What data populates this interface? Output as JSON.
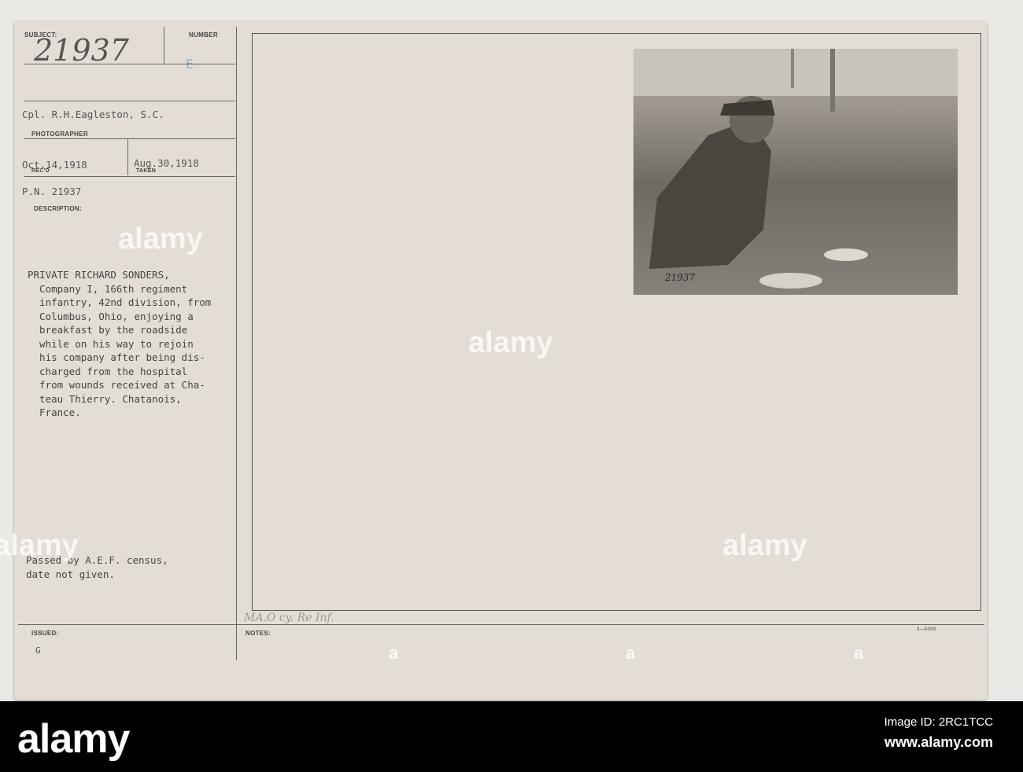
{
  "card": {
    "subject_label": "SUBJECT:",
    "subject_value": "21937",
    "number_label": "NUMBER",
    "number_value": "E",
    "photographer": "Cpl. R.H.Eagleston, S.C.",
    "photographer_label": "PHOTOGRAPHER",
    "received": "Oct.14,1918",
    "received_label": "REC'D",
    "taken": "Aug.30,1918",
    "taken_label": "TAKEN",
    "pn": "P.N. 21937",
    "description_label": "DESCRIPTION:",
    "description": "PRIVATE RICHARD SONDERS,\n  Company I, 166th regiment\n  infantry, 42nd division, from\n  Columbus, Ohio, enjoying a\n  breakfast by the roadside\n  while on his way to rejoin\n  his company after being dis-\n  charged from the hospital\n  from wounds received at Cha-\n  teau Thierry. Chatanois,\n  France.",
    "censor": "Passed by A.E.F. census,\ndate not given.",
    "issued_label": "ISSUED:",
    "issued_value": "G",
    "notes_label": "NOTES:",
    "notes_handwritten": "MA.O cy. Re Inf.",
    "form_number": "3—5005",
    "photo_number": "21937"
  },
  "watermark": {
    "brand": "alamy",
    "letter": "a"
  },
  "footer": {
    "image_id": "Image ID: 2RC1TCC",
    "url": "www.alamy.com"
  }
}
